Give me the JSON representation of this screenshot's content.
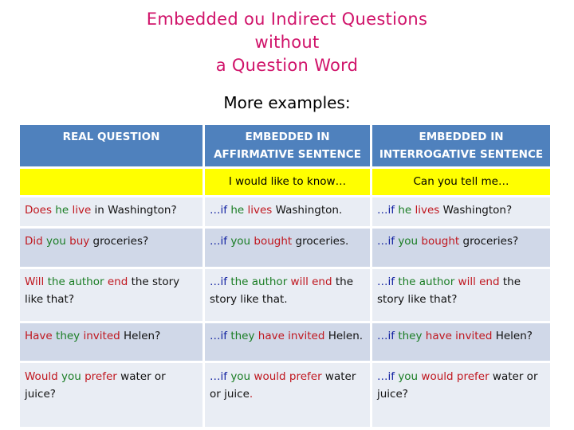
{
  "title": {
    "lines": [
      "Embedded ou Indirect Questions",
      "without",
      "a Question Word"
    ],
    "color": "#d0136a"
  },
  "subtitle": "More examples:",
  "table": {
    "header_color": "#4f81bd",
    "headers": [
      "REAL QUESTION",
      "EMBEDDED IN AFFIRMATIVE SENTENCE",
      "EMBEDDED IN INTERROGATIVE SENTENCE"
    ],
    "intro_row": [
      "",
      "I would like to know…",
      "Can you tell me…"
    ],
    "color_legend": {
      "red": "#c0171f",
      "green": "#1a7d24",
      "blue": "#0f1fa0"
    },
    "rows": [
      {
        "real": [
          [
            "red",
            "Does"
          ],
          [
            "black",
            " "
          ],
          [
            "green",
            "he"
          ],
          [
            "black",
            " "
          ],
          [
            "red",
            "live"
          ],
          [
            "black",
            " in Washington?"
          ]
        ],
        "affirmative": [
          [
            "blue",
            "…if"
          ],
          [
            "black",
            " "
          ],
          [
            "green",
            "he"
          ],
          [
            "black",
            " "
          ],
          [
            "red",
            "lives"
          ],
          [
            "black",
            " Washington."
          ]
        ],
        "interrogative": [
          [
            "blue",
            "…if"
          ],
          [
            "black",
            " "
          ],
          [
            "green",
            "he"
          ],
          [
            "black",
            " "
          ],
          [
            "red",
            "lives"
          ],
          [
            "black",
            " Washington?"
          ]
        ]
      },
      {
        "real": [
          [
            "red",
            "Did"
          ],
          [
            "black",
            " "
          ],
          [
            "green",
            "you"
          ],
          [
            "black",
            " "
          ],
          [
            "red",
            "buy"
          ],
          [
            "black",
            " groceries?"
          ]
        ],
        "affirmative": [
          [
            "blue",
            "…if"
          ],
          [
            "black",
            " "
          ],
          [
            "green",
            "you"
          ],
          [
            "black",
            " "
          ],
          [
            "red",
            "bought"
          ],
          [
            "black",
            " groceries."
          ]
        ],
        "interrogative": [
          [
            "blue",
            "…if"
          ],
          [
            "black",
            " "
          ],
          [
            "green",
            "you"
          ],
          [
            "black",
            " "
          ],
          [
            "red",
            "bought"
          ],
          [
            "black",
            " groceries?"
          ]
        ]
      },
      {
        "real": [
          [
            "red",
            "Will"
          ],
          [
            "black",
            " "
          ],
          [
            "green",
            "the author"
          ],
          [
            "black",
            " "
          ],
          [
            "red",
            "end"
          ],
          [
            "black",
            " the story like that?"
          ]
        ],
        "affirmative": [
          [
            "blue",
            "…if"
          ],
          [
            "black",
            " "
          ],
          [
            "green",
            "the author"
          ],
          [
            "black",
            " "
          ],
          [
            "red",
            "will end"
          ],
          [
            "black",
            " the story like that."
          ]
        ],
        "interrogative": [
          [
            "blue",
            "…if"
          ],
          [
            "black",
            " "
          ],
          [
            "green",
            "the author"
          ],
          [
            "black",
            " "
          ],
          [
            "red",
            "will end"
          ],
          [
            "black",
            " the story like that?"
          ]
        ]
      },
      {
        "real": [
          [
            "red",
            "Have"
          ],
          [
            "black",
            " "
          ],
          [
            "green",
            "they"
          ],
          [
            "black",
            " "
          ],
          [
            "red",
            "invited"
          ],
          [
            "black",
            " Helen?"
          ]
        ],
        "affirmative": [
          [
            "blue",
            "…if"
          ],
          [
            "black",
            " "
          ],
          [
            "green",
            "they"
          ],
          [
            "black",
            " "
          ],
          [
            "red",
            "have invited"
          ],
          [
            "black",
            " Helen."
          ]
        ],
        "interrogative": [
          [
            "blue",
            "…if"
          ],
          [
            "black",
            " "
          ],
          [
            "green",
            "they"
          ],
          [
            "black",
            " "
          ],
          [
            "red",
            "have invited"
          ],
          [
            "black",
            " Helen?"
          ]
        ]
      },
      {
        "real": [
          [
            "red",
            "Would"
          ],
          [
            "black",
            " "
          ],
          [
            "green",
            "you"
          ],
          [
            "black",
            " "
          ],
          [
            "red",
            "prefer"
          ],
          [
            "black",
            " water or juice?"
          ]
        ],
        "affirmative": [
          [
            "blue",
            "…if"
          ],
          [
            "black",
            " "
          ],
          [
            "green",
            "you"
          ],
          [
            "black",
            " "
          ],
          [
            "red",
            "would prefer"
          ],
          [
            "black",
            " water or juice"
          ],
          [
            "red",
            "."
          ]
        ],
        "interrogative": [
          [
            "blue",
            "…if"
          ],
          [
            "black",
            " "
          ],
          [
            "green",
            "you"
          ],
          [
            "black",
            " "
          ],
          [
            "red",
            "would prefer"
          ],
          [
            "black",
            " water or juice?"
          ]
        ]
      }
    ]
  }
}
